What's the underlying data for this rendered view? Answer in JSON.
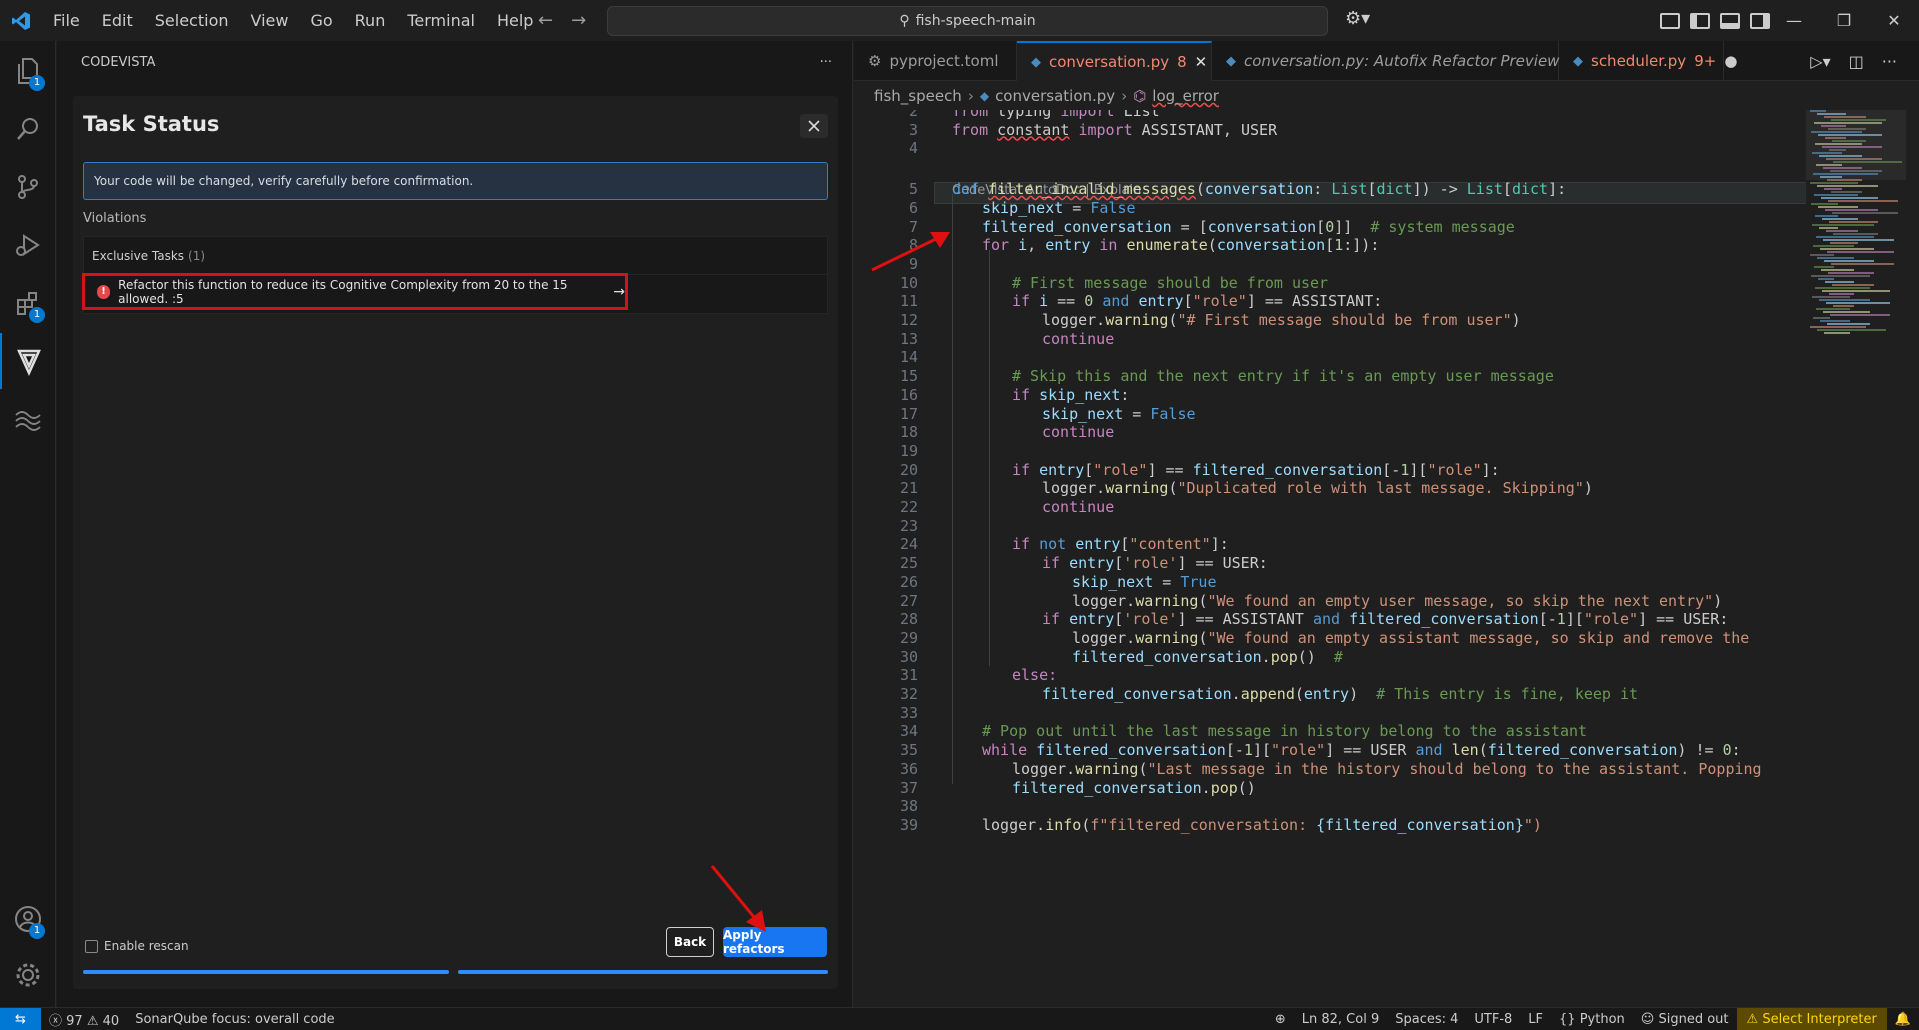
{
  "titlebar": {
    "menus": [
      "File",
      "Edit",
      "Selection",
      "View",
      "Go",
      "Run",
      "Terminal",
      "Help"
    ],
    "search": "fish-speech-main"
  },
  "activity": {
    "explorer_badge": "1",
    "extensions_badge": "1",
    "accounts_badge": "1"
  },
  "sidebar": {
    "title": "CODEVISTA",
    "more": "···",
    "panel_title": "Task Status",
    "notice": "Your code will be changed, verify carefully before confirmation.",
    "violations_label": "Violations",
    "exclusive_label": "Exclusive Tasks",
    "exclusive_count": "(1)",
    "violation_text": "Refactor this function to reduce its Cognitive Complexity from 20 to the 15 allowed. :5",
    "rescan_label": "Enable rescan",
    "back_label": "Back",
    "apply_label": "Apply refactors"
  },
  "tabs": [
    {
      "label": "pyproject.toml",
      "badge": ""
    },
    {
      "label": "conversation.py",
      "badge": "8"
    },
    {
      "label": "conversation.py: Autofix Refactor Preview",
      "badge": ""
    },
    {
      "label": "scheduler.py",
      "badge": "9+"
    }
  ],
  "breadcrumb": {
    "folder": "fish_speech",
    "file": "conversation.py",
    "symbol": "log_error"
  },
  "editor": {
    "codelens": "CodeVista: AutoDoc | Explain",
    "line_numbers": [
      "2",
      "3",
      "4",
      "5",
      "6",
      "7",
      "8",
      "9",
      "10",
      "11",
      "12",
      "13",
      "14",
      "15",
      "16",
      "17",
      "18",
      "19",
      "20",
      "21",
      "22",
      "23",
      "24",
      "25",
      "26",
      "27",
      "28",
      "29",
      "30",
      "31",
      "32",
      "33",
      "34",
      "35",
      "36",
      "37",
      "38",
      "39"
    ]
  },
  "code": {
    "l2": [
      "from",
      " typing ",
      "import",
      " List"
    ],
    "l3": [
      "from",
      " ",
      "constant",
      " ",
      "import",
      " ASSISTANT, USER"
    ],
    "l5": [
      "def",
      " ",
      "filter_invalid_messages",
      "(",
      "conversation",
      ": ",
      "List",
      "[",
      "dict",
      "]) -> ",
      "List",
      "[",
      "dict",
      "]:"
    ],
    "l6": [
      "skip_next",
      " = ",
      "False"
    ],
    "l7": [
      "filtered_conversation",
      " = [",
      "conversation",
      "[",
      "0",
      "]]  ",
      "# system message"
    ],
    "l8": [
      "for",
      " ",
      "i",
      ", ",
      "entry",
      " ",
      "in",
      " ",
      "enumerate",
      "(",
      "conversation",
      "[",
      "1",
      ":]):"
    ],
    "l10": "# First message should be from user",
    "l11": [
      "if",
      " ",
      "i",
      " == ",
      "0",
      " ",
      "and",
      " ",
      "entry",
      "[",
      "\"role\"",
      "] == ASSISTANT:"
    ],
    "l12": [
      "logger.",
      "warning",
      "(",
      "\"# First message should be from user\"",
      ")"
    ],
    "l13": "continue",
    "l15": "# Skip this and the next entry if it's an empty user message",
    "l16": [
      "if",
      " ",
      "skip_next",
      ":"
    ],
    "l17": [
      "skip_next",
      " = ",
      "False"
    ],
    "l18": "continue",
    "l20": [
      "if",
      " ",
      "entry",
      "[",
      "\"role\"",
      "] == ",
      "filtered_conversation",
      "[-",
      "1",
      "][",
      "\"role\"",
      "]:"
    ],
    "l21": [
      "logger.",
      "warning",
      "(",
      "\"Duplicated role with last message. Skipping\"",
      ")"
    ],
    "l22": "continue",
    "l24": [
      "if",
      " ",
      "not",
      " ",
      "entry",
      "[",
      "\"content\"",
      "]:"
    ],
    "l25": [
      "if",
      " ",
      "entry",
      "[",
      "'role'",
      "] == USER:"
    ],
    "l26": [
      "skip_next",
      " = ",
      "True"
    ],
    "l27": [
      "logger.",
      "warning",
      "(",
      "\"We found an empty user message, so skip the next entry\"",
      ")"
    ],
    "l28": [
      "if",
      " ",
      "entry",
      "[",
      "'role'",
      "] == ASSISTANT ",
      "and",
      " ",
      "filtered_conversation",
      "[-",
      "1",
      "][",
      "\"role\"",
      "] == USER:"
    ],
    "l29": [
      "logger.",
      "warning",
      "(",
      "\"We found an empty assistant message, so skip and remove the"
    ],
    "l30": [
      "filtered_conversation",
      ".",
      "pop",
      "()  ",
      "#"
    ],
    "l31": "else:",
    "l32": [
      "filtered_conversation",
      ".",
      "append",
      "(",
      "entry",
      ")  ",
      "# This entry is fine, keep it"
    ],
    "l34": "# Pop out until the last message in history belong to the assistant",
    "l35": [
      "while",
      " ",
      "filtered_conversation",
      "[-",
      "1",
      "][",
      "\"role\"",
      "] == USER ",
      "and",
      " ",
      "len",
      "(",
      "filtered_conversation",
      ") != ",
      "0",
      ":"
    ],
    "l36": [
      "logger.",
      "warning",
      "(",
      "\"Last message in the history should belong to the assistant. Popping"
    ],
    "l37": [
      "filtered_conversation",
      ".",
      "pop",
      "()"
    ],
    "l39": [
      "logger.",
      "info",
      "(",
      "f\"filtered_conversation: ",
      "{filtered_conversation}",
      "\")"
    ]
  },
  "statusbar": {
    "errors": "97",
    "warnings": "40",
    "sonar": "SonarQube focus: overall code",
    "position": "Ln 82, Col 9",
    "spaces": "Spaces: 4",
    "encoding": "UTF-8",
    "eol": "LF",
    "language": "Python",
    "signed": "Signed out",
    "interpreter": "Select Interpreter"
  },
  "colors": {
    "accent": "#0078d4",
    "annotation": "#e01010",
    "apply_button": "#1976f2"
  }
}
